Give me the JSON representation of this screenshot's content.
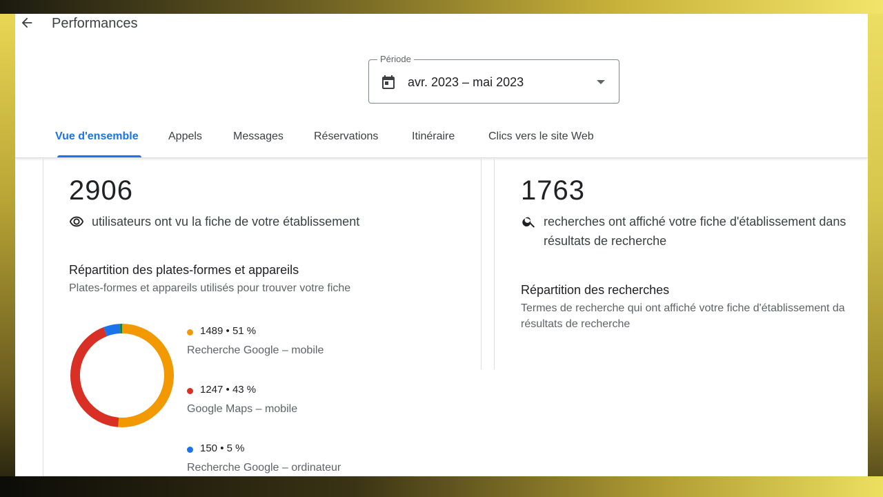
{
  "header": {
    "back_icon": "arrow-left-icon",
    "title": "Performances"
  },
  "period": {
    "label": "Période",
    "value": "avr. 2023 – mai 2023",
    "icon": "calendar-icon"
  },
  "tabs": [
    {
      "label": "Vue d'ensemble",
      "active": true
    },
    {
      "label": "Appels",
      "active": false
    },
    {
      "label": "Messages",
      "active": false
    },
    {
      "label": "Réservations",
      "active": false
    },
    {
      "label": "Itinéraire",
      "active": false
    },
    {
      "label": "Clics vers le site Web",
      "active": false
    }
  ],
  "left_card": {
    "total": "2906",
    "icon": "eye-icon",
    "description": "utilisateurs ont vu la fiche de votre établissement",
    "section_title": "Répartition des plates-formes et appareils",
    "section_subtitle": "Plates-formes et appareils utilisés pour trouver votre fiche"
  },
  "right_card": {
    "total": "1763",
    "icon": "search-icon",
    "description_line1": "recherches ont affiché votre fiche d'établissement dans",
    "description_line2": "résultats de recherche",
    "section_title": "Répartition des recherches",
    "section_subtitle_line1": "Termes de recherche qui ont affiché votre fiche d'établissement da",
    "section_subtitle_line2": "résultats de recherche"
  },
  "chart_data": {
    "type": "pie",
    "categories": [
      "Recherche Google – mobile",
      "Google Maps – mobile",
      "Recherche Google – ordinateur",
      ""
    ],
    "values": [
      1489,
      1247,
      150,
      20
    ],
    "percent_labels": [
      "1489 • 51 %",
      "1247 • 43 %",
      "150 • 5 %"
    ],
    "colors": [
      "#f29900",
      "#d93025",
      "#1a73e8",
      "#188038"
    ]
  },
  "legend": [
    {
      "value_text": "1489 • 51 %",
      "label": "Recherche Google – mobile",
      "color": "#f29900"
    },
    {
      "value_text": "1247 • 43 %",
      "label": "Google Maps – mobile",
      "color": "#d93025"
    },
    {
      "value_text": "150 • 5 %",
      "label": "Recherche Google – ordinateur",
      "color": "#1a73e8"
    }
  ]
}
